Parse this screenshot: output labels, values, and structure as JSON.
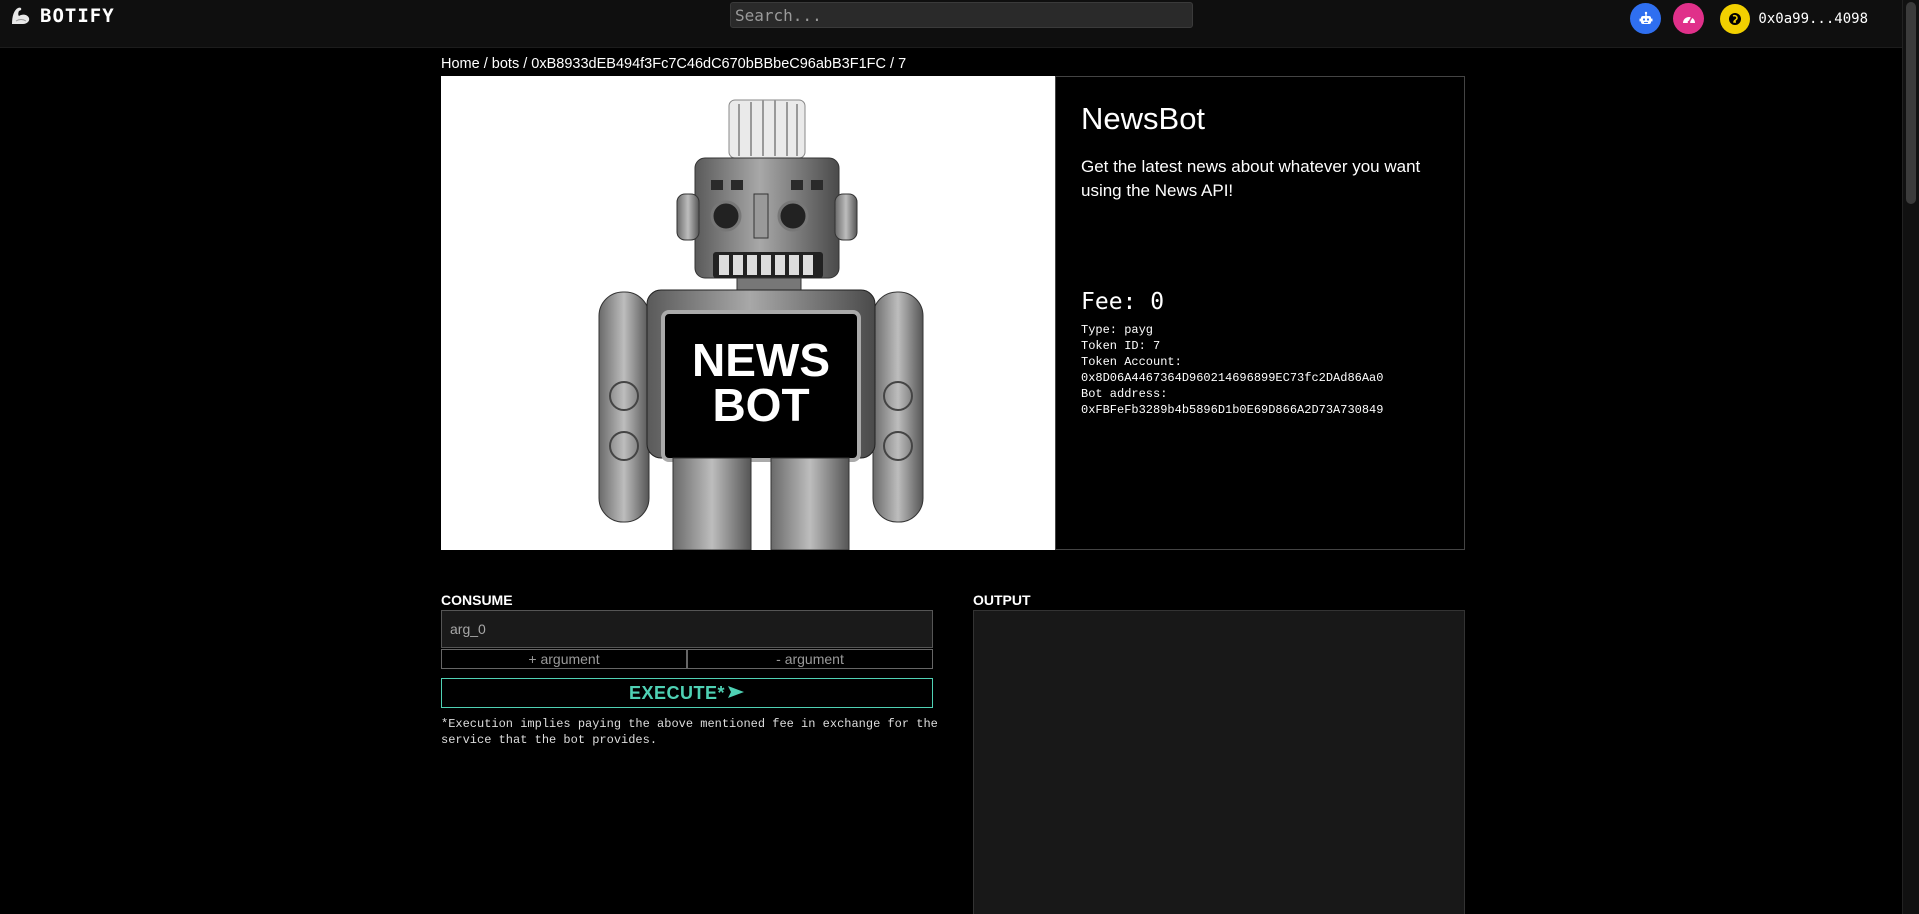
{
  "header": {
    "brand": "BOTIFY",
    "search_placeholder": "Search...",
    "wallet_address": "0x0a99...4098"
  },
  "breadcrumb": {
    "home": "Home",
    "bots": "bots",
    "address": "0xB8933dEB494f3Fc7C46dC670bBBbeC96abB3F1FC",
    "token": "7",
    "sep": "/"
  },
  "bot": {
    "image_text_line1": "NEWS",
    "image_text_line2": "BOT",
    "name": "NewsBot",
    "description": "Get the latest news about whatever you want using the News API!",
    "fee": "Fee: 0",
    "type": "Type: payg",
    "token_id": "Token ID: 7",
    "token_account_label": "Token Account:",
    "token_account": "0x8D06A4467364D960214696899EC73fc2DAd86Aa0",
    "bot_address_label": "Bot address:",
    "bot_address": "0xFBFeFb3289b4b5896D1b0E69D866A2D73A730849"
  },
  "consume": {
    "label": "CONSUME",
    "arg_placeholder": "arg_0",
    "add_argument": "+ argument",
    "remove_argument": "- argument",
    "execute_label": "EXECUTE*",
    "disclaimer": "*Execution implies paying the above mentioned fee in exchange for the service that the bot provides."
  },
  "output": {
    "label": "OUTPUT"
  },
  "colors": {
    "accent": "#4fd1b4",
    "bots_button": "#2f6ff0",
    "dashboard_button": "#e0308a",
    "wallet_avatar": "#f2d000"
  },
  "icons": {
    "logo": "arm-flex-icon",
    "bots_button": "robot-icon",
    "dashboard_button": "speedometer-icon",
    "wallet_avatar": "coin-icon",
    "execute": "send-arrow-icon"
  }
}
